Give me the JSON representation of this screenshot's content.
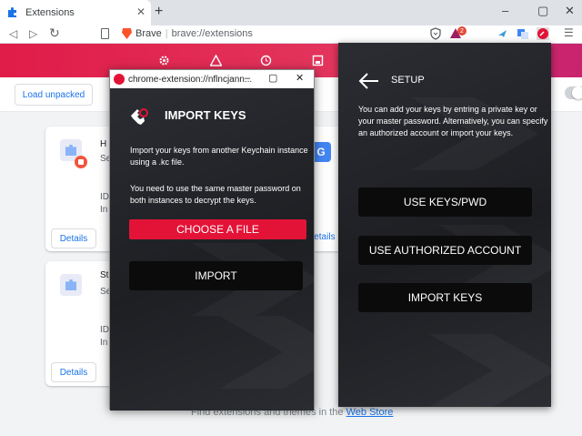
{
  "browser": {
    "tab_title": "Extensions",
    "url_brand": "Brave",
    "url_separator": "|",
    "url_path": "brave://extensions",
    "window_controls": {
      "minimize": "–",
      "maximize": "▢",
      "close": "✕"
    },
    "tab_close": "✕",
    "new_tab": "+",
    "nav": {
      "back": "◁",
      "forward": "▷",
      "reload": "↻"
    },
    "menu_icon": "☰",
    "rewards_badge": "2"
  },
  "extensions_page": {
    "load_unpacked": "Load unpacked",
    "cards": [
      {
        "name_trunc": "H",
        "desc_trunc": "Se",
        "id_trunc": "ID",
        "inspect_trunc": "In",
        "details": "Details"
      },
      {
        "name_trunc": "St",
        "desc_trunc": "Se",
        "id_trunc": "ID",
        "inspect_trunc": "In",
        "details": "Details"
      }
    ],
    "right_card_details": "Details",
    "right_card_icon_letter": "G",
    "footer_text": "Find extensions and themes in the ",
    "footer_link": "Web Store"
  },
  "popup": {
    "title": "chrome-extension://nflncjann...",
    "heading": "IMPORT KEYS",
    "paragraph1": "Import your keys from another Keychain instance using a .kc file.",
    "paragraph2": "You need to use the same master password on both instances to decrypt the keys.",
    "choose_file_label": "CHOOSE A FILE",
    "import_label": "IMPORT",
    "accent_color": "#e31337"
  },
  "setup": {
    "title": "SETUP",
    "description": "You can add your keys by entring a private key or your master password. Alternatively, you can specify an authorized account or import your keys.",
    "buttons": [
      "USE KEYS/PWD",
      "USE AUTHORIZED ACCOUNT",
      "IMPORT KEYS"
    ]
  },
  "header_icons": [
    "gear-icon",
    "warning-icon",
    "history-icon",
    "save-icon"
  ]
}
